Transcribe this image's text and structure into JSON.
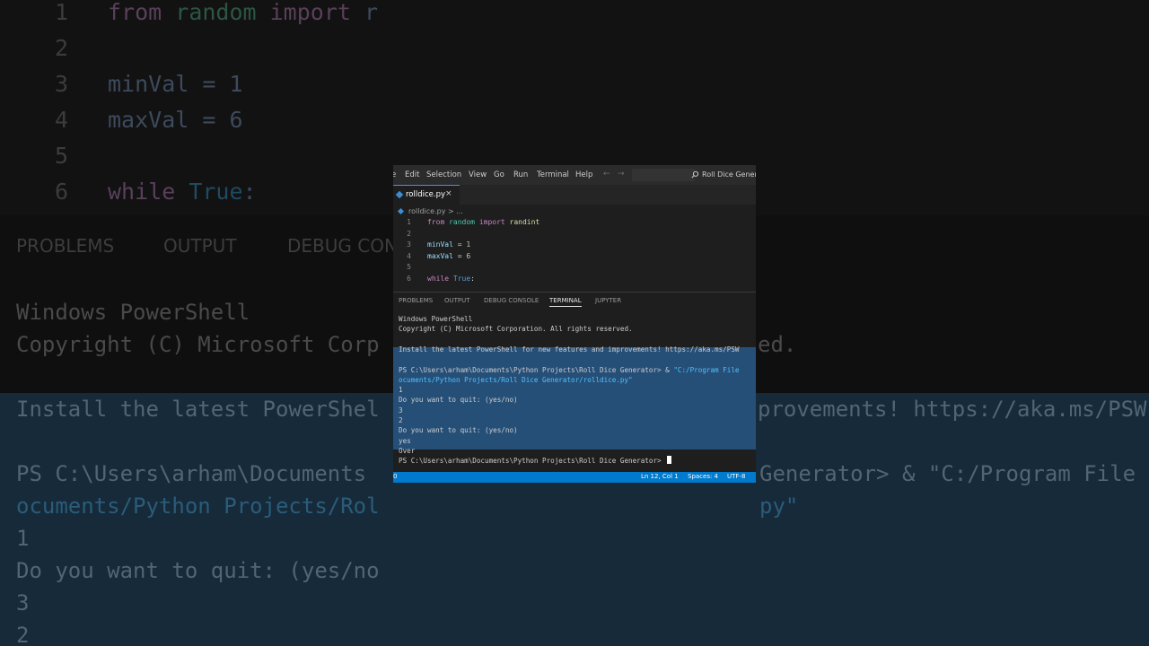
{
  "background": {
    "code_lines": [
      {
        "num": "1",
        "parts": [
          {
            "t": "from ",
            "c": "kw"
          },
          {
            "t": "random ",
            "c": "cls"
          },
          {
            "t": "import ",
            "c": "kw"
          },
          {
            "t": "r",
            "c": ""
          }
        ]
      },
      {
        "num": "2",
        "parts": []
      },
      {
        "num": "3",
        "parts": [
          {
            "t": "minVal = 1",
            "c": ""
          }
        ]
      },
      {
        "num": "4",
        "parts": [
          {
            "t": "maxVal = 6",
            "c": ""
          }
        ]
      },
      {
        "num": "5",
        "parts": []
      },
      {
        "num": "6",
        "parts": [
          {
            "t": "while ",
            "c": "kw"
          },
          {
            "t": "True",
            "c": "bt"
          },
          {
            "t": ":",
            "c": ""
          }
        ]
      }
    ],
    "panel_tabs": [
      "PROBLEMS",
      "OUTPUT",
      "DEBUG CON"
    ],
    "terminal_lines": [
      {
        "text": "Windows PowerShell",
        "sel": false
      },
      {
        "text": "Copyright (C) Microsoft Corp",
        "sel": false
      },
      {
        "text": "Install the latest PowerShel",
        "sel": true
      },
      {
        "text": "PS C:\\Users\\arham\\Documents",
        "sel": true
      },
      {
        "text": "ocuments/Python Projects/Rol",
        "sel": true,
        "link": true
      },
      {
        "text": "1",
        "sel": true
      },
      {
        "text": "Do you want to quit: (yes/no",
        "sel": true
      },
      {
        "text": "3",
        "sel": true
      },
      {
        "text": "2",
        "sel": true
      }
    ],
    "right_fragments": [
      {
        "text": "ed.",
        "sel": false
      },
      {
        "text": "provements! https://aka.ms/PSW",
        "sel": true
      },
      {
        "text": "Generator> & \"C:/Program File",
        "sel": true
      },
      {
        "text": "py\"",
        "sel": true,
        "link": true
      }
    ]
  },
  "menubar": {
    "items": [
      "Edit",
      "Selection",
      "View",
      "Go",
      "Run",
      "Terminal",
      "Help"
    ],
    "back_icon": "arrow-left-icon",
    "forward_icon": "arrow-right-icon",
    "title": "Roll Dice Generat"
  },
  "editor": {
    "tab_label": "rolldice.py",
    "close_glyph": "×",
    "breadcrumb": "rolldice.py > ...",
    "lines": [
      {
        "num": "1",
        "parts": [
          {
            "t": "from ",
            "c": "kw"
          },
          {
            "t": "random ",
            "c": "cls"
          },
          {
            "t": "import ",
            "c": "kw"
          },
          {
            "t": "randint",
            "c": "fn"
          }
        ]
      },
      {
        "num": "2",
        "parts": []
      },
      {
        "num": "3",
        "parts": [
          {
            "t": "minVal",
            "c": "var"
          },
          {
            "t": " = ",
            "c": ""
          },
          {
            "t": "1",
            "c": "num"
          }
        ]
      },
      {
        "num": "4",
        "parts": [
          {
            "t": "maxVal",
            "c": "var"
          },
          {
            "t": " = ",
            "c": ""
          },
          {
            "t": "6",
            "c": "num"
          }
        ]
      },
      {
        "num": "5",
        "parts": []
      },
      {
        "num": "6",
        "parts": [
          {
            "t": "while ",
            "c": "kw"
          },
          {
            "t": "True",
            "c": "bt"
          },
          {
            "t": ":",
            "c": ""
          }
        ]
      }
    ]
  },
  "panel": {
    "tabs": [
      "PROBLEMS",
      "OUTPUT",
      "DEBUG CONSOLE",
      "TERMINAL",
      "JUPYTER"
    ],
    "active_tab": "TERMINAL"
  },
  "terminal": {
    "lines": [
      {
        "text": "Windows PowerShell"
      },
      {
        "text": "Copyright (C) Microsoft Corporation. All rights reserved."
      },
      {
        "text": ""
      },
      {
        "text": "Install the latest PowerShell for new features and improvements! https://aka.ms/PSW"
      },
      {
        "text": ""
      },
      {
        "text": "PS C:\\Users\\arham\\Documents\\Python Projects\\Roll Dice Generator> & ",
        "link": "\"C:/Program File"
      },
      {
        "text": "",
        "link": "ocuments/Python Projects/Roll Dice Generator/rolldice.py\""
      },
      {
        "text": "1"
      },
      {
        "text": "Do you want to quit: (yes/no)"
      },
      {
        "text": "3"
      },
      {
        "text": "2"
      },
      {
        "text": "Do you want to quit: (yes/no)"
      },
      {
        "text": "yes"
      },
      {
        "text": "Over"
      },
      {
        "text": "PS C:\\Users\\arham\\Documents\\Python Projects\\Roll Dice Generator> ",
        "cursor": true
      }
    ]
  },
  "status": {
    "left": "0",
    "position": "Ln 12, Col 1",
    "spaces": "Spaces: 4",
    "encoding": "UTF-8"
  }
}
